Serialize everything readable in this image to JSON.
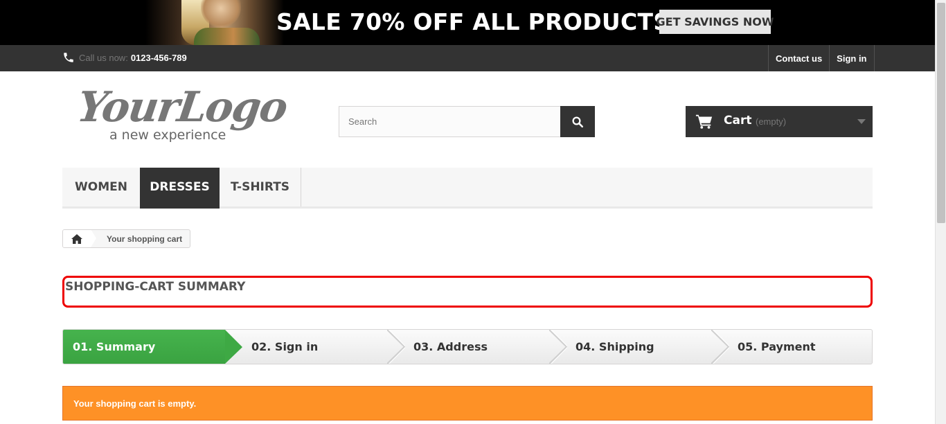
{
  "banner": {
    "headline": "SALE 70% OFF ALL PRODUCTS",
    "cta_label": "GET SAVINGS NOW"
  },
  "topnav": {
    "phone_prefix": "Call us now:",
    "phone_number": "0123-456-789",
    "links": [
      "Contact us",
      "Sign in"
    ]
  },
  "logo": {
    "main": "YourLogo",
    "tagline": "a new experience"
  },
  "search": {
    "placeholder": "Search",
    "icon": "search-icon"
  },
  "cart": {
    "label": "Cart",
    "status": "(empty)",
    "icon": "cart-icon"
  },
  "menu": {
    "items": [
      "WOMEN",
      "DRESSES",
      "T-SHIRTS"
    ],
    "active": "DRESSES"
  },
  "breadcrumb": {
    "home_icon": "home-icon",
    "current": "Your shopping cart"
  },
  "page": {
    "heading": "SHOPPING-CART SUMMARY"
  },
  "steps": [
    "01. Summary",
    "02. Sign in",
    "03. Address",
    "04. Shipping",
    "05. Payment"
  ],
  "alert": {
    "message": "Your shopping cart is empty."
  },
  "colors": {
    "dark": "#333333",
    "active_step": "#46b34d",
    "alert": "#fe9126",
    "highlight": "#ee0000"
  }
}
